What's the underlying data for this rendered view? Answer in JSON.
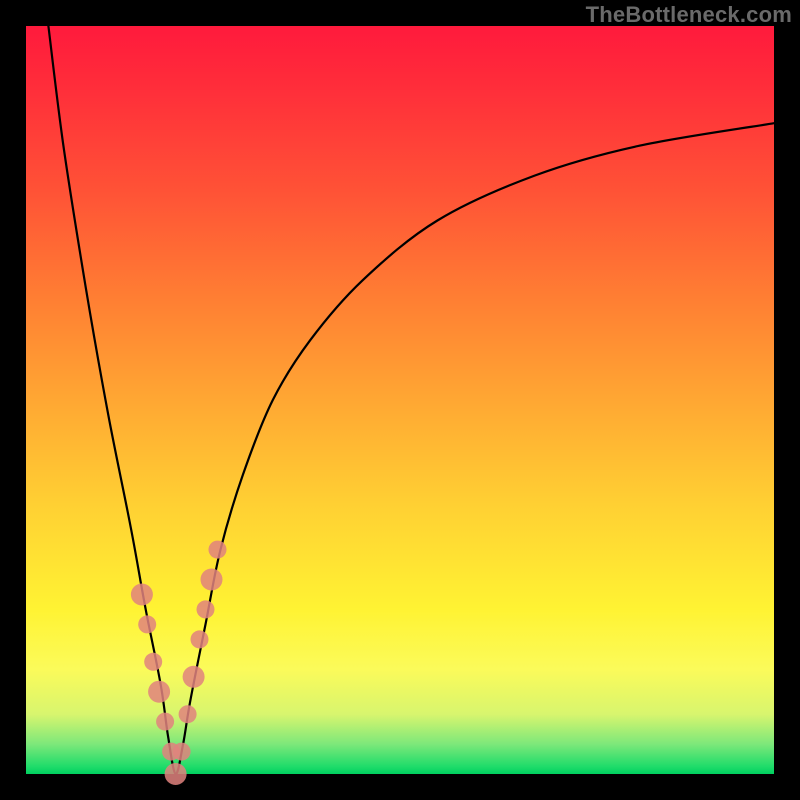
{
  "watermark": "TheBottleneck.com",
  "colors": {
    "frame": "#000000",
    "curve": "#000000",
    "marker": "#e0837e",
    "gradient_top": "#ff1a3c",
    "gradient_bottom": "#00d060"
  },
  "chart_data": {
    "type": "line",
    "title": "",
    "xlabel": "",
    "ylabel": "",
    "xlim": [
      0,
      100
    ],
    "ylim": [
      0,
      100
    ],
    "note": "Bottleneck-style V curve. x is relative component scale (0–100), y is bottleneck percentage (0 = no bottleneck at bottom, 100 = max bottleneck at top). Minimum near x≈20.",
    "series": [
      {
        "name": "bottleneck-curve",
        "x": [
          3,
          5,
          8,
          11,
          14,
          16,
          18,
          19,
          20,
          21,
          22,
          24,
          26,
          29,
          33,
          38,
          45,
          55,
          68,
          82,
          100
        ],
        "y": [
          100,
          84,
          65,
          48,
          33,
          22,
          12,
          5,
          0,
          4,
          10,
          20,
          30,
          40,
          50,
          58,
          66,
          74,
          80,
          84,
          87
        ]
      }
    ],
    "markers": {
      "name": "highlighted-points",
      "x": [
        15.5,
        16.2,
        17.0,
        17.8,
        18.6,
        19.4,
        20.0,
        20.8,
        21.6,
        22.4,
        23.2,
        24.0,
        24.8,
        25.6
      ],
      "y": [
        24,
        20,
        15,
        11,
        7,
        3,
        0,
        3,
        8,
        13,
        18,
        22,
        26,
        30
      ]
    }
  }
}
